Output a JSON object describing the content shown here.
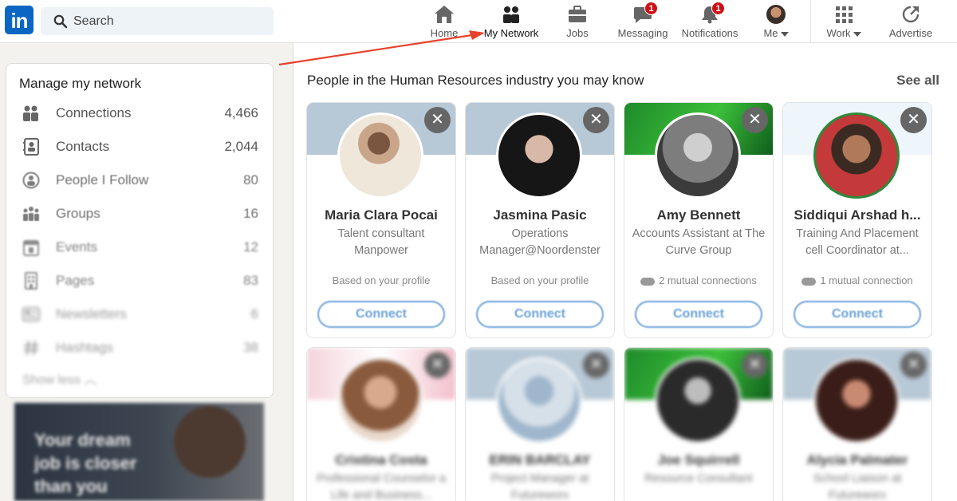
{
  "nav": {
    "search_placeholder": "Search",
    "items": [
      {
        "label": "Home"
      },
      {
        "label": "My Network"
      },
      {
        "label": "Jobs"
      },
      {
        "label": "Messaging",
        "badge": "1"
      },
      {
        "label": "Notifications",
        "badge": "1"
      },
      {
        "label": "Me"
      },
      {
        "label": "Work"
      },
      {
        "label": "Advertise"
      }
    ]
  },
  "sidebar": {
    "title": "Manage my network",
    "items": [
      {
        "label": "Connections",
        "count": "4,466"
      },
      {
        "label": "Contacts",
        "count": "2,044"
      },
      {
        "label": "People I Follow",
        "count": "80"
      },
      {
        "label": "Groups",
        "count": "16"
      },
      {
        "label": "Events",
        "count": "12"
      },
      {
        "label": "Pages",
        "count": "83"
      },
      {
        "label": "Newsletters",
        "count": "6"
      },
      {
        "label": "Hashtags",
        "count": "38"
      }
    ],
    "show_less": "Show less",
    "promo_text": "Your dream job is closer than you"
  },
  "main": {
    "section_title": "People in the Human Resources industry you may know",
    "see_all": "See all",
    "connect_label": "Connect",
    "cards": [
      {
        "name": "Maria Clara Pocai",
        "title": "Talent consultant Manpower",
        "reason": "Based on your profile"
      },
      {
        "name": "Jasmina Pasic",
        "title": "Operations Manager@Noordenster",
        "reason": "Based on your profile"
      },
      {
        "name": "Amy Bennett",
        "title": "Accounts Assistant at The Curve Group",
        "reason": "2 mutual connections"
      },
      {
        "name": "Siddiqui Arshad h...",
        "title": "Training And Placement cell Coordinator at...",
        "reason": "1 mutual connection"
      },
      {
        "name": "Cristina Costa",
        "title": "Professional Counselor a Life and Business..."
      },
      {
        "name": "ERIN BARCLAY",
        "title": "Project Manager at Futureworx"
      },
      {
        "name": "Joe Squirrell",
        "title": "Resource Consultant"
      },
      {
        "name": "Alycia Palmater",
        "title": "School Liaison at Futureworx"
      }
    ]
  },
  "colors": {
    "brand": "#0a66c2",
    "badge": "#cc1016",
    "annotation_arrow": "#e8412c"
  }
}
